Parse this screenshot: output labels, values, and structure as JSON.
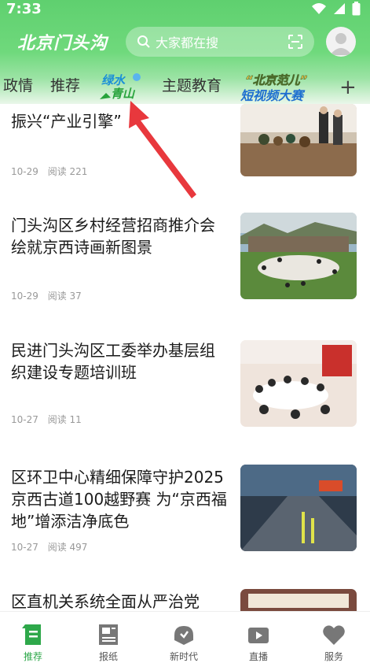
{
  "status_bar": {
    "time": "7:33"
  },
  "header": {
    "logo": "北京门头沟",
    "search_placeholder": "大家都在搜"
  },
  "tabs": [
    {
      "label": "政情"
    },
    {
      "label": "推荐"
    },
    {
      "label": "绿水青山"
    },
    {
      "label": "主题教育"
    },
    {
      "label": "北京范儿短视频大赛"
    }
  ],
  "tab_add": "+",
  "articles": [
    {
      "title": "振兴“产业引擎”",
      "date": "10-29",
      "reads": "阅读 221"
    },
    {
      "title": "门头沟区乡村经营招商推介会绘就京西诗画新图景",
      "date": "10-29",
      "reads": "阅读 37"
    },
    {
      "title": "民进门头沟区工委举办基层组织建设专题培训班",
      "date": "10-27",
      "reads": "阅读 11"
    },
    {
      "title": "区环卫中心精细保障守护2025京西古道100越野赛 为“京西福地”增添洁净底色",
      "date": "10-27",
      "reads": "阅读 497"
    },
    {
      "title": "区直机关系统全面从严治党",
      "date": "",
      "reads": ""
    }
  ],
  "bottom_nav": [
    {
      "label": "推荐",
      "icon": "recommend-icon",
      "active": true
    },
    {
      "label": "报纸",
      "icon": "newspaper-icon",
      "active": false
    },
    {
      "label": "新时代",
      "icon": "new-era-icon",
      "active": false
    },
    {
      "label": "直播",
      "icon": "live-icon",
      "active": false
    },
    {
      "label": "服务",
      "icon": "service-icon",
      "active": false
    }
  ],
  "colors": {
    "brand_green": "#5fd06f",
    "active_green": "#2ea84a",
    "arrow_red": "#e8383d"
  }
}
